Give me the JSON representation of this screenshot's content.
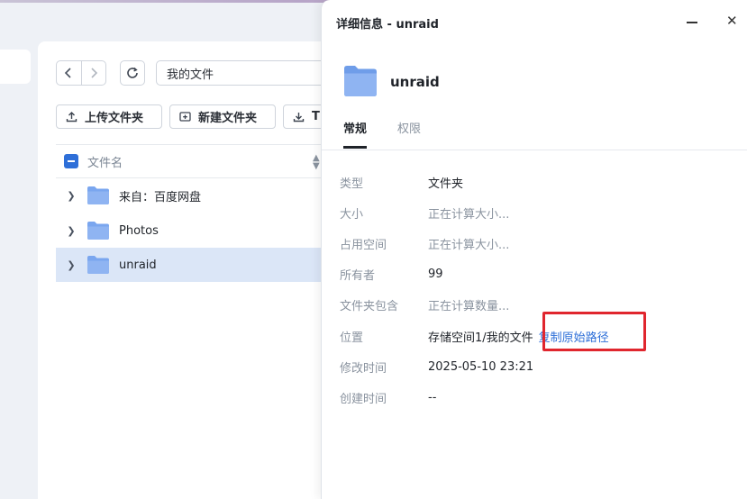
{
  "file_manager": {
    "path": "我的文件",
    "toolbar": {
      "upload_folder": "上传文件夹",
      "new_folder": "新建文件夹",
      "partial_button": "T"
    },
    "list": {
      "column_name": "文件名",
      "items": [
        {
          "name": "来自：百度网盘",
          "selected": false
        },
        {
          "name": "Photos",
          "selected": false
        },
        {
          "name": "unraid",
          "selected": true
        }
      ]
    }
  },
  "details": {
    "window_title": "详细信息 - unraid",
    "folder_name": "unraid",
    "tabs": [
      "常规",
      "权限"
    ],
    "properties": {
      "type_label": "类型",
      "type_value": "文件夹",
      "size_label": "大小",
      "size_value": "正在计算大小...",
      "used_label": "占用空间",
      "used_value": "正在计算大小...",
      "owner_label": "所有者",
      "owner_value": "99",
      "contains_label": "文件夹包含",
      "contains_value": "正在计算数量...",
      "location_label": "位置",
      "location_value": "存储空间1/我的文件",
      "copy_path": "复制原始路径",
      "modified_label": "修改时间",
      "modified_value": "2025-05-10 23:21",
      "created_label": "创建时间",
      "created_value": "--"
    }
  },
  "colors": {
    "accent": "#2e6fd8",
    "folder": "#7aa6ef",
    "selected_row": "#dbe6f7",
    "highlight": "#e0262e"
  }
}
